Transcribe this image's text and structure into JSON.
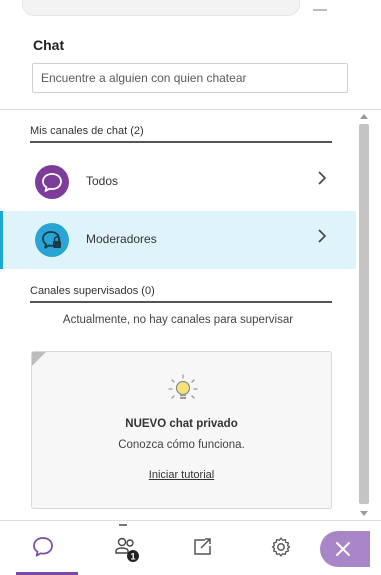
{
  "panel": {
    "title": "Chat",
    "search_placeholder": "Encuentre a alguien con quien chatear"
  },
  "my_channels": {
    "header": "Mis canales de chat (2)",
    "items": [
      {
        "label": "Todos",
        "icon": "chat-bubble-icon",
        "avatar_color": "#7d3c98",
        "selected": false
      },
      {
        "label": "Moderadores",
        "icon": "moderator-chat-icon",
        "avatar_color": "#2aa4d5",
        "selected": true
      }
    ]
  },
  "supervised_channels": {
    "header": "Canales supervisados (0)",
    "empty_text": "Actualmente, no hay canales para supervisar"
  },
  "tutorial": {
    "icon": "lightbulb-icon",
    "title": "NUEVO chat privado",
    "subtitle": "Conozca cómo funciona.",
    "link": "Iniciar tutorial"
  },
  "bottom_tabs": [
    {
      "name": "chat",
      "icon": "chat-icon",
      "active": true
    },
    {
      "name": "attendees",
      "icon": "attendees-icon",
      "badge": "1"
    },
    {
      "name": "share",
      "icon": "share-content-icon"
    },
    {
      "name": "settings",
      "icon": "gear-icon"
    },
    {
      "name": "close",
      "icon": "close-icon"
    }
  ],
  "colors": {
    "accent_purple": "#7a4aa8",
    "selected_bg": "#dff3fa",
    "selected_accent": "#1fa8d6",
    "close_button": "#a986c7"
  }
}
